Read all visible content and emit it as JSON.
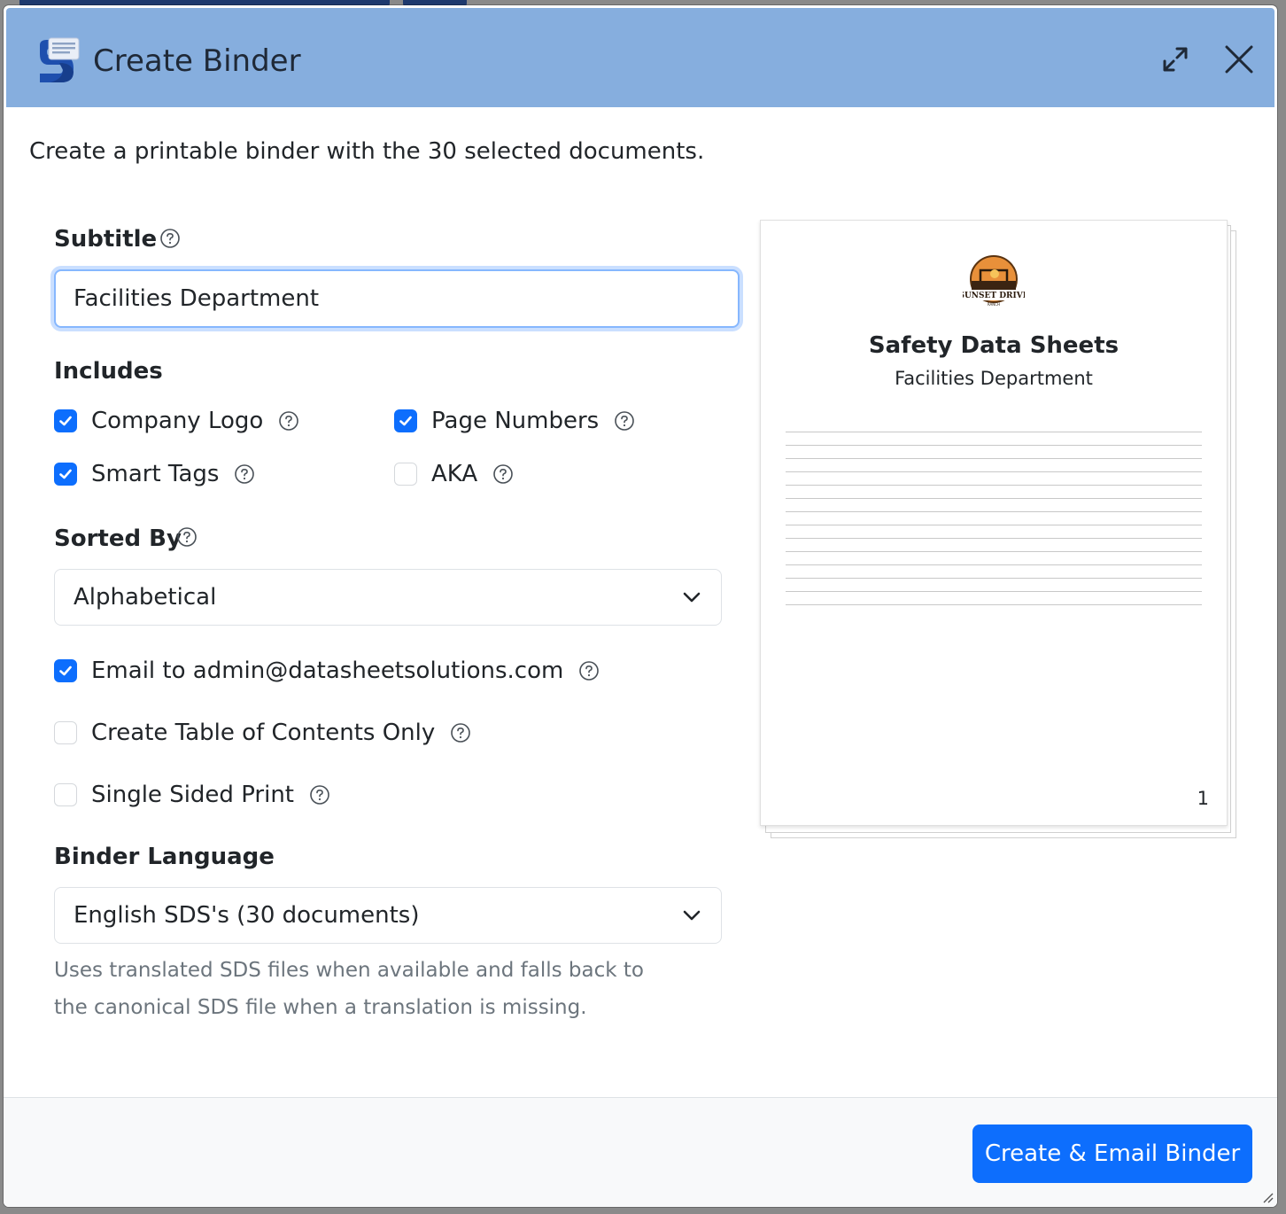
{
  "dialog": {
    "title": "Create Binder",
    "intro": "Create a printable binder with the 30 selected documents."
  },
  "subtitle": {
    "label": "Subtitle",
    "value": "Facilities Department"
  },
  "includes": {
    "label": "Includes",
    "options": [
      {
        "label": "Company Logo",
        "checked": true
      },
      {
        "label": "Page Numbers",
        "checked": true
      },
      {
        "label": "Smart Tags",
        "checked": true
      },
      {
        "label": "AKA",
        "checked": false
      }
    ]
  },
  "sorted_by": {
    "label": "Sorted By",
    "value": "Alphabetical"
  },
  "options": {
    "email": {
      "label": "Email to admin@datasheetsolutions.com",
      "checked": true
    },
    "toc_only": {
      "label": "Create Table of Contents Only",
      "checked": false
    },
    "single_sided": {
      "label": "Single Sided Print",
      "checked": false
    }
  },
  "binder_language": {
    "label": "Binder Language",
    "value": "English SDS's (30 documents)",
    "hint": "Uses translated SDS files when available and falls back to the canonical SDS file when a translation is missing."
  },
  "preview": {
    "logo_text": "SUNSET DRIVE",
    "logo_subtext": "RANCH",
    "title": "Safety Data Sheets",
    "subtitle": "Facilities Department",
    "page_number": "1",
    "line_count": 14
  },
  "footer": {
    "submit_label": "Create & Email Binder"
  },
  "colors": {
    "header_bg": "#86aede",
    "primary": "#0d6efd"
  },
  "icons": {
    "app": "app-logo-icon",
    "expand": "expand-icon",
    "close": "close-icon",
    "help": "help-circle-icon",
    "check": "check-icon",
    "chevron": "chevron-down-icon"
  }
}
